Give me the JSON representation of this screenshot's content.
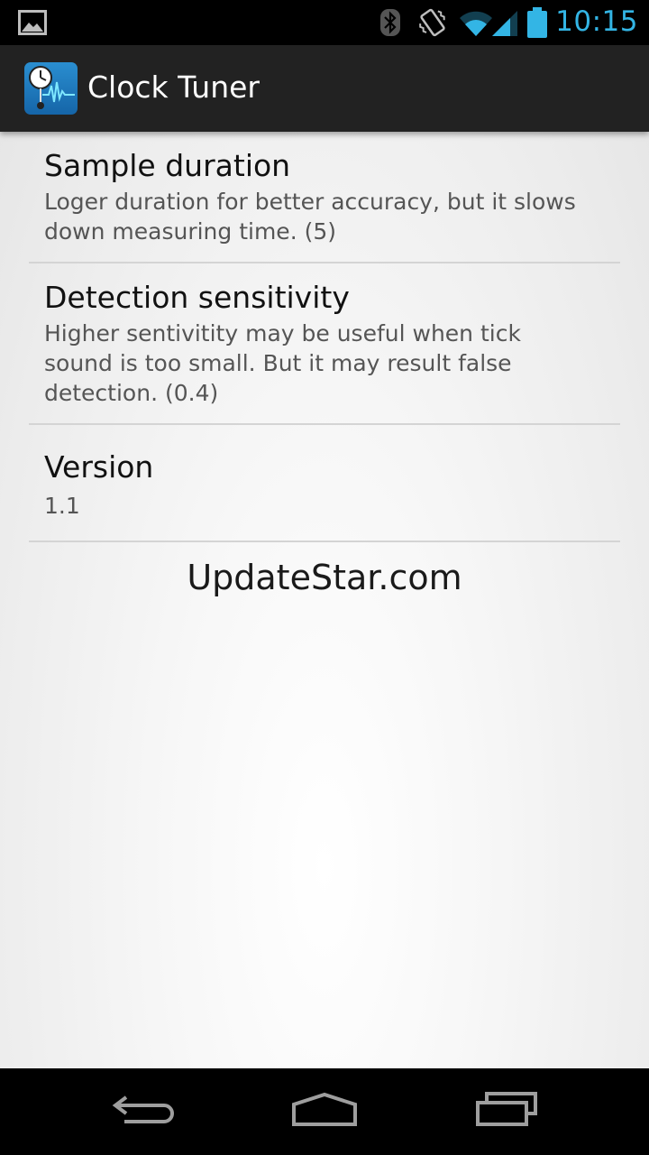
{
  "status_bar": {
    "time": "10:15",
    "icons": [
      "image-notification-icon",
      "bluetooth-icon",
      "vibrate-icon",
      "wifi-icon",
      "signal-icon",
      "battery-icon"
    ],
    "accent_color": "#33b5e5"
  },
  "app_bar": {
    "title": "Clock Tuner",
    "icon": "clock-tuner-app-icon"
  },
  "preferences": [
    {
      "title": "Sample duration",
      "summary": "Loger duration for better accuracy, but it slows down measuring time. (5)"
    },
    {
      "title": "Detection sensitivity",
      "summary": "Higher sentivitity may be useful when tick sound is too small. But it may result false detection. (0.4)"
    },
    {
      "title": "Version",
      "summary": "1.1"
    }
  ],
  "watermark": "UpdateStar.com",
  "nav_bar": {
    "icons": [
      "back-icon",
      "home-icon",
      "recent-apps-icon"
    ]
  }
}
